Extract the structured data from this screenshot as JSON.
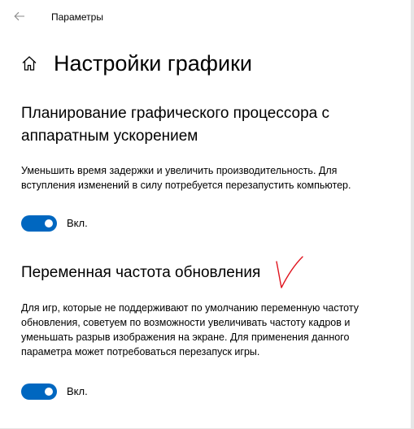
{
  "window": {
    "app_title": "Параметры",
    "back_icon": "arrow-left-icon"
  },
  "header": {
    "home_icon": "home-icon",
    "page_title": "Настройки графики"
  },
  "sections": [
    {
      "title": "Планирование графического процессора с аппаратным ускорением",
      "description": "Уменьшить время задержки и увеличить производительность. Для вступления изменений в силу потребуется перезапустить компьютер.",
      "toggle": {
        "state": "on",
        "label": "Вкл."
      }
    },
    {
      "title": "Переменная частота обновления",
      "description": "Для игр, которые не поддерживают по умолчанию переменную частоту обновления, советуем по возможности увеличивать частоту кадров и уменьшать разрыв изображения на экране. Для применения данного параметра может потребоваться перезапуск игры.",
      "toggle": {
        "state": "on",
        "label": "Вкл."
      }
    }
  ],
  "colors": {
    "accent": "#0067c0",
    "annotation": "#e0141e"
  }
}
